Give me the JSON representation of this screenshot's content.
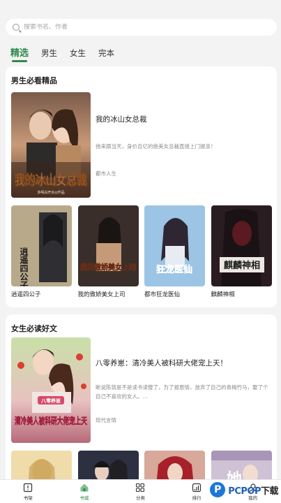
{
  "search": {
    "placeholder": "搜索书名、作者"
  },
  "tabs": [
    {
      "label": "精选",
      "active": true
    },
    {
      "label": "男生"
    },
    {
      "label": "女生"
    },
    {
      "label": "完本"
    }
  ],
  "section_male": {
    "title": "男生必看精品",
    "featured": {
      "title": "我的冰山女总裁",
      "desc": "他来婿当天，身价百亿的绝美女总裁直接上门提亲！",
      "genre": "都市人生",
      "cover_text": "我的冰山女总裁",
      "cover_sub": "多喝白开水◎作品"
    },
    "books": [
      {
        "name": "逍遥四公子",
        "cover_text": "逍遥四公子"
      },
      {
        "name": "我的傲娇美女上司",
        "cover_text": "我的傲娇美女上司"
      },
      {
        "name": "都市狂龙医仙",
        "cover_text": "狂龙医仙"
      },
      {
        "name": "麒麟神相",
        "cover_text": "麒麟神相"
      }
    ]
  },
  "section_female": {
    "title": "女生必读好文",
    "featured": {
      "title": "八零养崽：清冷美人被科研大佬宠上天！",
      "desc": "断说陈筑是不是读书读傻了，为了报恩情，放弃了自己的青梅竹马，娶了个自己不喜欢的女人。...",
      "genre": "现代言情",
      "cover_text": "清冷美人被科研大佬宠上天",
      "cover_tag": "八零养崽"
    }
  },
  "nav": [
    {
      "label": "书架",
      "icon": "bookshelf-icon"
    },
    {
      "label": "书城",
      "icon": "bookstore-icon",
      "active": true
    },
    {
      "label": "分类",
      "icon": "category-icon"
    },
    {
      "label": "排行",
      "icon": "ranking-icon"
    },
    {
      "label": "我的",
      "icon": "profile-icon"
    }
  ],
  "watermark": {
    "brand": "PCPOP",
    "suffix": "下载"
  },
  "colors": {
    "accent": "#2f8a4c",
    "background": "#f2f3f2"
  }
}
